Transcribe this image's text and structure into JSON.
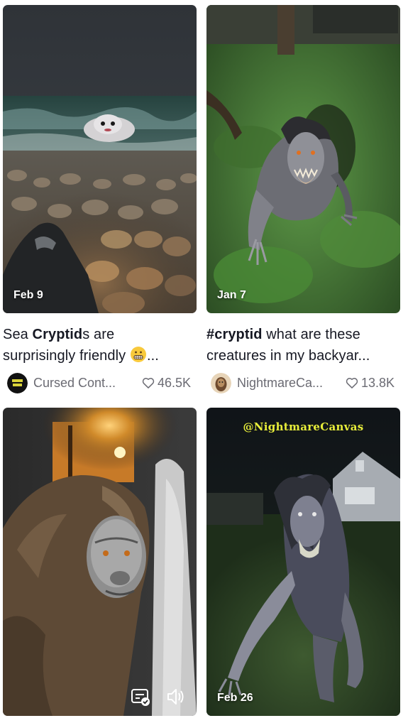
{
  "videos": [
    {
      "date": "Feb 9",
      "caption_line1_pre": "Sea ",
      "caption_line1_bold": "Cryptid",
      "caption_line1_post": "s are",
      "caption_line2": "surprisingly friendly",
      "caption_line2_tail": "...",
      "emoji": "grimacing-face",
      "author": "Cursed Cont...",
      "likes": "46.5K"
    },
    {
      "date": "Jan 7",
      "caption_line1_bold": "#cryptid",
      "caption_line1_post": " what are these",
      "caption_line2": "creatures in my backyar...",
      "author": "NightmareCa...",
      "likes": "13.8K"
    },
    {
      "date": "",
      "icons": [
        "captions-icon",
        "speaker-icon"
      ]
    },
    {
      "date": "Feb 26",
      "overlay_text": "@NightmareCanvas"
    }
  ],
  "colors": {
    "text": "#161823",
    "muted": "#6b6b73",
    "overlay_handle": "#e8ee3a"
  }
}
